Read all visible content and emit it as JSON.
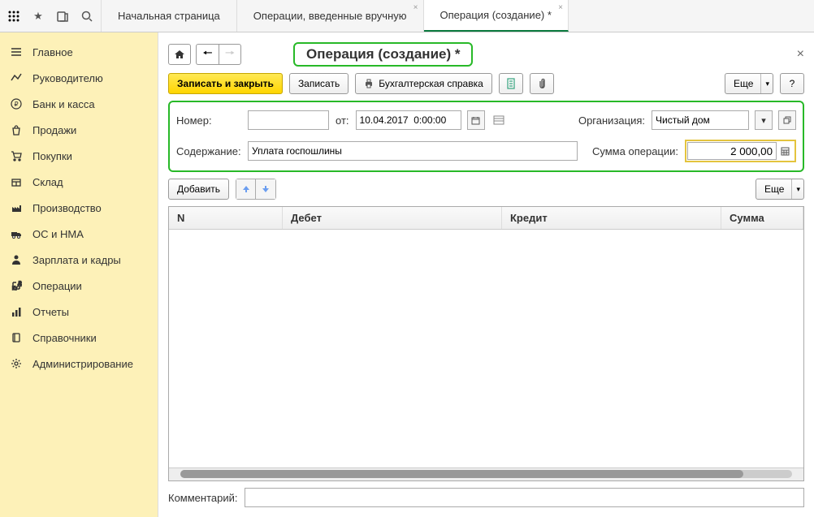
{
  "top_tabs": [
    {
      "label": "Начальная страница",
      "closable": false
    },
    {
      "label": "Операции, введенные вручную",
      "closable": true
    },
    {
      "label": "Операция (создание) *",
      "closable": true,
      "active": true
    }
  ],
  "sidebar": {
    "items": [
      {
        "label": "Главное",
        "icon": "menu"
      },
      {
        "label": "Руководителю",
        "icon": "chart"
      },
      {
        "label": "Банк и касса",
        "icon": "ruble"
      },
      {
        "label": "Продажи",
        "icon": "bag"
      },
      {
        "label": "Покупки",
        "icon": "cart"
      },
      {
        "label": "Склад",
        "icon": "box"
      },
      {
        "label": "Производство",
        "icon": "factory"
      },
      {
        "label": "ОС и НМА",
        "icon": "truck"
      },
      {
        "label": "Зарплата и кадры",
        "icon": "person"
      },
      {
        "label": "Операции",
        "icon": "ops"
      },
      {
        "label": "Отчеты",
        "icon": "bars"
      },
      {
        "label": "Справочники",
        "icon": "book"
      },
      {
        "label": "Администрирование",
        "icon": "gear"
      }
    ]
  },
  "page": {
    "title": "Операция (создание) *",
    "actions": {
      "save_close": "Записать и закрыть",
      "save": "Записать",
      "report": "Бухгалтерская справка",
      "more": "Еще",
      "help": "?"
    },
    "form": {
      "number_label": "Номер:",
      "number_value": "",
      "date_label": "от:",
      "date_value": "10.04.2017  0:00:00",
      "org_label": "Организация:",
      "org_value": "Чистый дом",
      "content_label": "Содержание:",
      "content_value": "Уплата госпошлины",
      "sum_label": "Сумма операции:",
      "sum_value": "2 000,00"
    },
    "table": {
      "add": "Добавить",
      "more": "Еще",
      "columns": {
        "n": "N",
        "debit": "Дебет",
        "credit": "Кредит",
        "sum": "Сумма"
      }
    },
    "comment_label": "Комментарий:",
    "comment_value": ""
  }
}
